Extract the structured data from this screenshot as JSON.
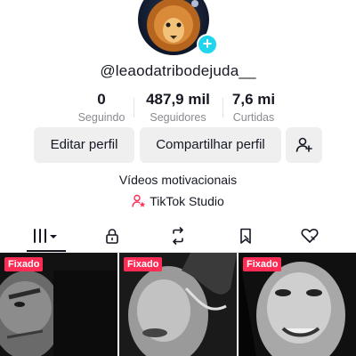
{
  "profile": {
    "username": "@leaodatribodejuda__",
    "avatar_icon": "lion-avatar",
    "add_icon": "plus-icon",
    "bio": "Vídeos motivacionais",
    "studio_label": "TikTok Studio"
  },
  "stats": [
    {
      "value": "0",
      "label": "Seguindo"
    },
    {
      "value": "487,9 mil",
      "label": "Seguidores"
    },
    {
      "value": "7,6 mi",
      "label": "Curtidas"
    }
  ],
  "actions": {
    "edit_label": "Editar perfil",
    "share_label": "Compartilhar perfil",
    "add_friends_icon": "add-user-icon"
  },
  "tabs": [
    {
      "icon": "grid-icon",
      "active": true
    },
    {
      "icon": "lock-icon",
      "active": false
    },
    {
      "icon": "repost-icon",
      "active": false
    },
    {
      "icon": "bookmark-icon",
      "active": false
    },
    {
      "icon": "liked-icon",
      "active": false
    }
  ],
  "videos": [
    {
      "badge": "Fixado"
    },
    {
      "badge": "Fixado"
    },
    {
      "badge": "Fixado"
    }
  ],
  "colors": {
    "accent": "#fe2c55",
    "badge_plus": "#20d5ec",
    "button_bg": "#efeff0",
    "secondary_text": "#8a8b91"
  }
}
